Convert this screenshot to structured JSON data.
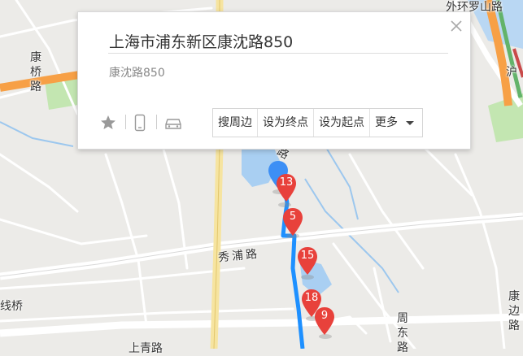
{
  "popup": {
    "title": "上海市浦东新区康沈路850",
    "subtitle": "康沈路850",
    "actions": {
      "search_nearby": "搜周边",
      "set_destination": "设为终点",
      "set_origin": "设为起点",
      "more": "更多"
    },
    "icons": [
      "star-icon",
      "phone-icon",
      "car-icon",
      "close-icon",
      "chevron-down-icon"
    ]
  },
  "map": {
    "road_labels": {
      "kangqiao_road": "康桥路",
      "xiupu_road": "秀浦路",
      "waihuan_luoshan": "外环罗山路",
      "hu_label": "沪",
      "xian_bridge": "线桥",
      "zhoudong_road": "周东路",
      "kangbian_road": "康边路",
      "lu_fragment": "路",
      "bottom_fragment": "上青路"
    },
    "markers": [
      {
        "id": "marker-blue",
        "label": ""
      },
      {
        "id": "13",
        "label": "13"
      },
      {
        "id": "5",
        "label": "5"
      },
      {
        "id": "15",
        "label": "15"
      },
      {
        "id": "18",
        "label": "18"
      },
      {
        "id": "9",
        "label": "9"
      }
    ],
    "colors": {
      "route": "#1e90ff",
      "marker": "#e8413b",
      "highway": "#f7a046",
      "water": "#a8cff2",
      "green": "#b7e2a6"
    }
  }
}
